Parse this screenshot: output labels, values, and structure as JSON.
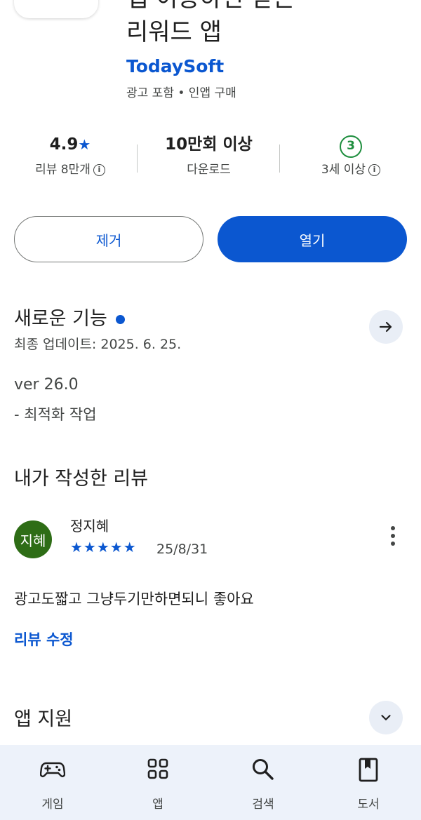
{
  "app": {
    "title_clipped": "앱 이용하면 받는",
    "title": "리워드 앱",
    "developer": "TodaySoft",
    "tags": "광고 포함 • 인앱 구매"
  },
  "stats": {
    "rating": "4.9",
    "rating_star": "★",
    "reviews": "리뷰 8만개",
    "downloads": "10만회 이상",
    "downloads_label": "다운로드",
    "age_badge": "3",
    "age_label": "3세 이상"
  },
  "buttons": {
    "remove": "제거",
    "open": "열기"
  },
  "whats_new": {
    "title": "새로운 기능",
    "updated": "최종 업데이트: 2025. 6. 25.",
    "version": "ver 26.0",
    "notes": "- 최적화 작업"
  },
  "my_review": {
    "title": "내가 작성한 리뷰",
    "avatar": "지혜",
    "name": "정지혜",
    "stars": "★★★★★",
    "date": "25/8/31",
    "text": "광고도짧고 그냥두기만하면되니 좋아요",
    "edit_label": "리뷰 수정"
  },
  "app_support": {
    "title": "앱 지원"
  },
  "nav": {
    "items": [
      {
        "label": "게임",
        "icon": "gamepad-icon"
      },
      {
        "label": "앱",
        "icon": "apps-grid-icon"
      },
      {
        "label": "검색",
        "icon": "search-icon"
      },
      {
        "label": "도서",
        "icon": "book-icon"
      }
    ]
  },
  "colors": {
    "accent": "#0b57d0",
    "age_green": "#1e8e3e",
    "avatar_bg": "#2e6d16",
    "nav_bg": "#edf2fa"
  }
}
